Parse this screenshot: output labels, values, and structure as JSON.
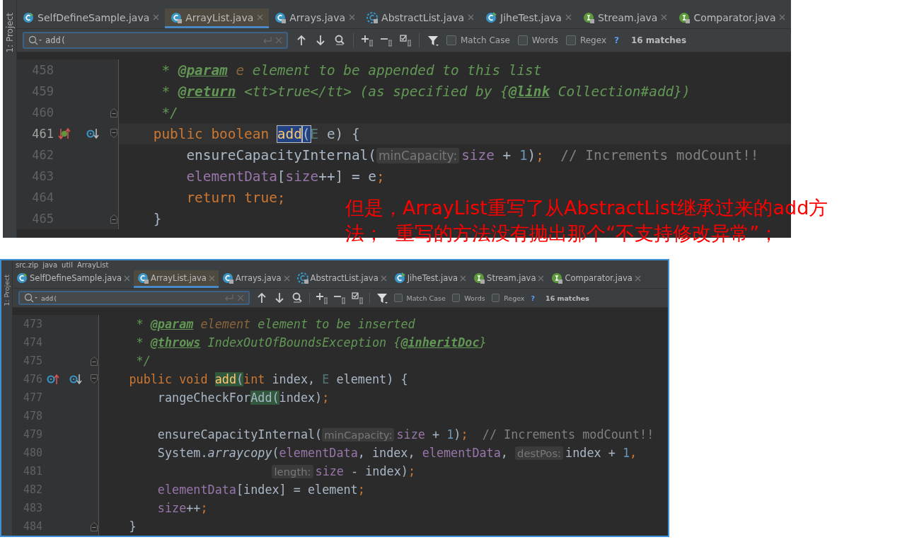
{
  "panels": [
    {
      "sidebar_label": "1: Project",
      "tabs": [
        {
          "label": "SelfDefineSample.java",
          "selected": false
        },
        {
          "label": "ArrayList.java",
          "selected": true
        },
        {
          "label": "Arrays.java",
          "selected": false
        },
        {
          "label": "AbstractList.java",
          "selected": false
        },
        {
          "label": "JiheTest.java",
          "selected": false
        },
        {
          "label": "Stream.java",
          "selected": false
        },
        {
          "label": "Comparator.java",
          "selected": false
        }
      ],
      "search": {
        "value": "add(",
        "options": [
          {
            "label": "Match Case",
            "checked": false
          },
          {
            "label": "Words",
            "checked": false
          },
          {
            "label": "Regex",
            "checked": false
          }
        ],
        "help": "?",
        "matches": "16 matches"
      },
      "lines": [
        {
          "number": "458",
          "current": false,
          "tokens": [
            {
              "text": "     * ",
              "kind": "comment"
            },
            {
              "text": "@param",
              "kind": "doctag"
            },
            {
              "text": " e",
              "kind": "docparam"
            },
            {
              "text": " element to be appended to this list",
              "kind": "comment"
            }
          ]
        },
        {
          "number": "459",
          "current": false,
          "tokens": [
            {
              "text": "     * ",
              "kind": "comment"
            },
            {
              "text": "@return",
              "kind": "doctag"
            },
            {
              "text": " <tt>true</tt> (as specified by {",
              "kind": "comment"
            },
            {
              "text": "@link",
              "kind": "doctag"
            },
            {
              "text": " Collection#add})",
              "kind": "comment"
            }
          ]
        },
        {
          "number": "460",
          "current": false,
          "tokens": [
            {
              "text": "     */",
              "kind": "comment"
            }
          ]
        },
        {
          "number": "461",
          "current": true,
          "tokens": [
            {
              "text": "    public boolean ",
              "kind": "keyword"
            },
            {
              "text": "add",
              "kind": "method",
              "match": true
            },
            {
              "text": "(",
              "kind": "plain",
              "match": true
            },
            {
              "text": "E",
              "kind": "typeparam"
            },
            {
              "text": " e) {",
              "kind": "plain"
            }
          ]
        },
        {
          "number": "462",
          "current": false,
          "tokens": [
            {
              "text": "        ensureCapacityInternal(",
              "kind": "plain"
            },
            {
              "text": "minCapacity:",
              "kind": "hint"
            },
            {
              "text": "size",
              "kind": "field"
            },
            {
              "text": " + ",
              "kind": "plain"
            },
            {
              "text": "1",
              "kind": "number"
            },
            {
              "text": ")",
              "kind": "plain"
            },
            {
              "text": ";",
              "kind": "keyword"
            },
            {
              "text": "  // Increments modCount!!",
              "kind": "linecomment"
            }
          ]
        },
        {
          "number": "463",
          "current": false,
          "tokens": [
            {
              "text": "        elementData",
              "kind": "field"
            },
            {
              "text": "[",
              "kind": "plain"
            },
            {
              "text": "size",
              "kind": "field"
            },
            {
              "text": "++] = e",
              "kind": "plain"
            },
            {
              "text": ";",
              "kind": "keyword"
            }
          ]
        },
        {
          "number": "464",
          "current": false,
          "tokens": [
            {
              "text": "        return true;",
              "kind": "keyword"
            }
          ]
        },
        {
          "number": "465",
          "current": false,
          "tokens": [
            {
              "text": "    }",
              "kind": "plain"
            }
          ]
        }
      ]
    },
    {
      "breadcrumb": [
        "src.zip",
        "java",
        "util",
        "ArrayList"
      ],
      "sidebar_label": "1: Project",
      "tabs": [
        {
          "label": "SelfDefineSample.java",
          "selected": false
        },
        {
          "label": "ArrayList.java",
          "selected": true
        },
        {
          "label": "Arrays.java",
          "selected": false
        },
        {
          "label": "AbstractList.java",
          "selected": false
        },
        {
          "label": "JiheTest.java",
          "selected": false
        },
        {
          "label": "Stream.java",
          "selected": false
        },
        {
          "label": "Comparator.java",
          "selected": false
        }
      ],
      "search": {
        "value": "add(",
        "options": [
          {
            "label": "Match Case",
            "checked": false
          },
          {
            "label": "Words",
            "checked": false
          },
          {
            "label": "Regex",
            "checked": false
          }
        ],
        "help": "?",
        "matches": "16 matches"
      },
      "lines": [
        {
          "number": "473",
          "current": false,
          "tokens": [
            {
              "text": "     * ",
              "kind": "comment"
            },
            {
              "text": "@param",
              "kind": "doctag"
            },
            {
              "text": " element",
              "kind": "docparam"
            },
            {
              "text": " element to be inserted",
              "kind": "comment"
            }
          ]
        },
        {
          "number": "474",
          "current": false,
          "tokens": [
            {
              "text": "     * ",
              "kind": "comment"
            },
            {
              "text": "@throws",
              "kind": "doctag"
            },
            {
              "text": " IndexOutOfBoundsException {",
              "kind": "comment"
            },
            {
              "text": "@inheritDoc",
              "kind": "doctag"
            },
            {
              "text": "}",
              "kind": "comment"
            }
          ]
        },
        {
          "number": "475",
          "current": false,
          "tokens": [
            {
              "text": "     */",
              "kind": "comment"
            }
          ]
        },
        {
          "number": "476",
          "current": false,
          "tokens": [
            {
              "text": "    public void ",
              "kind": "keyword"
            },
            {
              "text": "add",
              "kind": "method",
              "match": true
            },
            {
              "text": "(",
              "kind": "plain",
              "match": true
            },
            {
              "text": "int",
              "kind": "keyword"
            },
            {
              "text": " index, ",
              "kind": "plain"
            },
            {
              "text": "E",
              "kind": "typeparam"
            },
            {
              "text": " element) {",
              "kind": "plain"
            }
          ]
        },
        {
          "number": "477",
          "current": false,
          "tokens": [
            {
              "text": "        rangeCheckFor",
              "kind": "plain"
            },
            {
              "text": "Add(",
              "kind": "plain",
              "match": true
            },
            {
              "text": "index)",
              "kind": "plain"
            },
            {
              "text": ";",
              "kind": "keyword"
            }
          ]
        },
        {
          "number": "478",
          "current": false
        },
        {
          "number": "479",
          "current": false,
          "tokens": [
            {
              "text": "        ensureCapacityInternal(",
              "kind": "plain"
            },
            {
              "text": "minCapacity:",
              "kind": "hint"
            },
            {
              "text": "size",
              "kind": "field"
            },
            {
              "text": " + ",
              "kind": "plain"
            },
            {
              "text": "1",
              "kind": "number"
            },
            {
              "text": ")",
              "kind": "plain"
            },
            {
              "text": ";",
              "kind": "keyword"
            },
            {
              "text": "  // Increments modCount!!",
              "kind": "linecomment"
            }
          ]
        },
        {
          "number": "480",
          "current": false,
          "tokens": [
            {
              "text": "        System.",
              "kind": "plain"
            },
            {
              "text": "arraycopy",
              "kind": "italic"
            },
            {
              "text": "(",
              "kind": "plain"
            },
            {
              "text": "elementData",
              "kind": "field"
            },
            {
              "text": ", index, ",
              "kind": "plain"
            },
            {
              "text": "elementData",
              "kind": "field"
            },
            {
              "text": ", ",
              "kind": "plain"
            },
            {
              "text": "destPos:",
              "kind": "hint"
            },
            {
              "text": "index + ",
              "kind": "plain"
            },
            {
              "text": "1",
              "kind": "number"
            },
            {
              "text": ",",
              "kind": "keyword"
            }
          ]
        },
        {
          "number": "481",
          "current": false,
          "tokens": [
            {
              "text": "                        length:",
              "kind": "hint"
            },
            {
              "text": "size",
              "kind": "field"
            },
            {
              "text": " - index)",
              "kind": "plain"
            },
            {
              "text": ";",
              "kind": "keyword"
            }
          ]
        },
        {
          "number": "482",
          "current": false,
          "tokens": [
            {
              "text": "        elementData",
              "kind": "field"
            },
            {
              "text": "[index] = element",
              "kind": "plain"
            },
            {
              "text": ";",
              "kind": "keyword"
            }
          ]
        },
        {
          "number": "483",
          "current": false,
          "tokens": [
            {
              "text": "        size",
              "kind": "field"
            },
            {
              "text": "++",
              "kind": "plain"
            },
            {
              "text": ";",
              "kind": "keyword"
            }
          ]
        },
        {
          "number": "484",
          "current": false,
          "tokens": [
            {
              "text": "    }",
              "kind": "plain"
            }
          ]
        }
      ]
    }
  ],
  "annotation": "但是，ArrayList重写了从AbstractList继承过来的add方法；  重写的方法没有抛出那个“不支持修改异常”；"
}
